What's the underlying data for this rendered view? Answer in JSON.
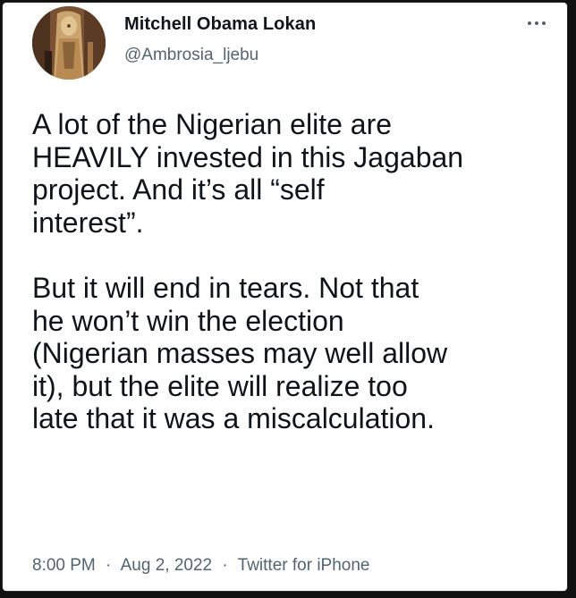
{
  "author": {
    "display_name": "Mitchell Obama Lokan",
    "handle": "@Ambrosia_ljebu",
    "avatar_icon": "profile-picture-painting"
  },
  "more_icon": "ellipsis-icon",
  "tweet": {
    "paragraph_1": "A lot of the Nigerian elite are\nHEAVILY invested in this Jagaban\nproject. And it’s all “self\ninterest”.",
    "paragraph_2": "But it will end in tears. Not that\nhe won’t win the election\n(Nigerian masses may well allow\nit), but the elite will realize too\nlate that it was a miscalculation."
  },
  "meta": {
    "time": "8:00 PM",
    "separator": "·",
    "date": "Aug 2, 2022",
    "source": "Twitter for iPhone"
  },
  "colors": {
    "text": "#0f1419",
    "secondary": "#536471",
    "background": "#ffffff"
  }
}
